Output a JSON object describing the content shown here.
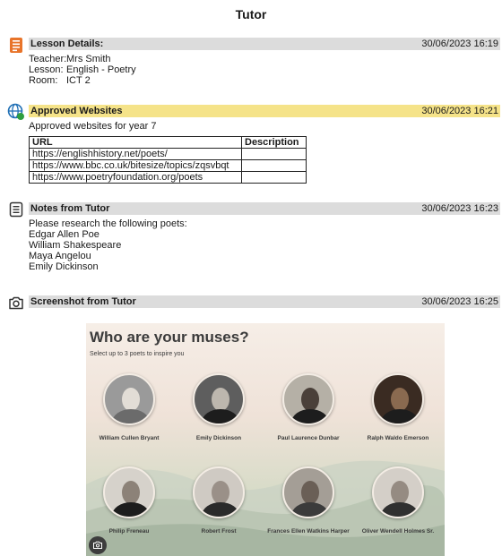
{
  "page": {
    "title": "Tutor"
  },
  "lesson": {
    "icon": "document-list-icon",
    "title": "Lesson Details:",
    "time": "30/06/2023 16:19",
    "rows": [
      {
        "key": "Teacher:",
        "value": "Mrs Smith"
      },
      {
        "key": "Lesson:",
        "value": "English - Poetry"
      },
      {
        "key": "Room:",
        "value": "ICT 2"
      }
    ]
  },
  "websites": {
    "icon": "globe-check-icon",
    "title": "Approved Websites",
    "time": "30/06/2023 16:21",
    "intro": "Approved websites for year 7",
    "columns": [
      "URL",
      "Description"
    ],
    "rows": [
      {
        "url": "https://englishhistory.net/poets/",
        "description": ""
      },
      {
        "url": "https://www.bbc.co.uk/bitesize/topics/zqsvbqt",
        "description": ""
      },
      {
        "url": "https://www.poetryfoundation.org/poets",
        "description": ""
      }
    ]
  },
  "notes": {
    "icon": "notes-icon",
    "title": "Notes from Tutor",
    "time": "30/06/2023 16:23",
    "lines": [
      "Please research the following poets:",
      "Edgar Allen Poe",
      "William Shakespeare",
      "Maya Angelou",
      "Emily Dickinson"
    ]
  },
  "screenshot": {
    "icon": "camera-icon",
    "title": "Screenshot from Tutor",
    "time": "30/06/2023 16:25",
    "heading": "Who are your muses?",
    "subheading": "Select up to 3 poets to inspire you",
    "poets": [
      {
        "name": "William Cullen Bryant"
      },
      {
        "name": "Emily Dickinson"
      },
      {
        "name": "Paul Laurence Dunbar"
      },
      {
        "name": "Ralph Waldo Emerson"
      },
      {
        "name": "Philip Freneau"
      },
      {
        "name": "Robert Frost"
      },
      {
        "name": "Frances Ellen Watkins Harper"
      },
      {
        "name": "Oliver Wendell Holmes Sr."
      }
    ],
    "colors": {
      "accent_bar": "#dcdcdc",
      "highlight_bar": "#f5e389",
      "lesson_icon": "#e8742a",
      "globe_icon": "#1f6fb5"
    }
  }
}
